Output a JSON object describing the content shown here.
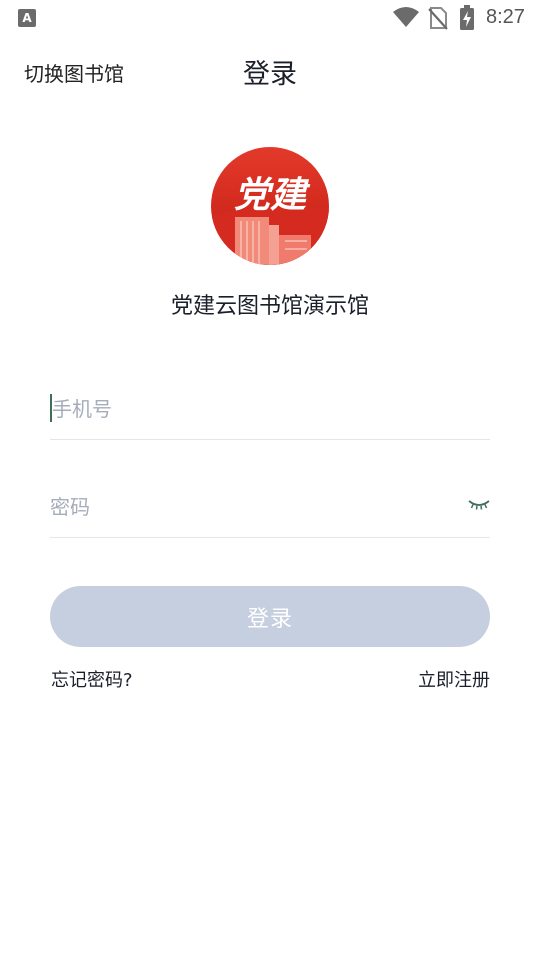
{
  "status_bar": {
    "notification_icon": "A",
    "time": "8:27",
    "icons": [
      "wifi-icon",
      "no-sim-icon",
      "battery-charging-icon"
    ]
  },
  "header": {
    "switch_library": "切换图书馆",
    "title": "登录"
  },
  "logo": {
    "text": "党建",
    "colors": {
      "primary": "#d5231c",
      "light": "#f07a6b"
    }
  },
  "library_name": "党建云图书馆演示馆",
  "form": {
    "phone_placeholder": "手机号",
    "password_placeholder": "密码",
    "login_button": "登录",
    "login_button_color": "#c6cfdf"
  },
  "links": {
    "forgot_password": "忘记密码?",
    "register": "立即注册"
  }
}
